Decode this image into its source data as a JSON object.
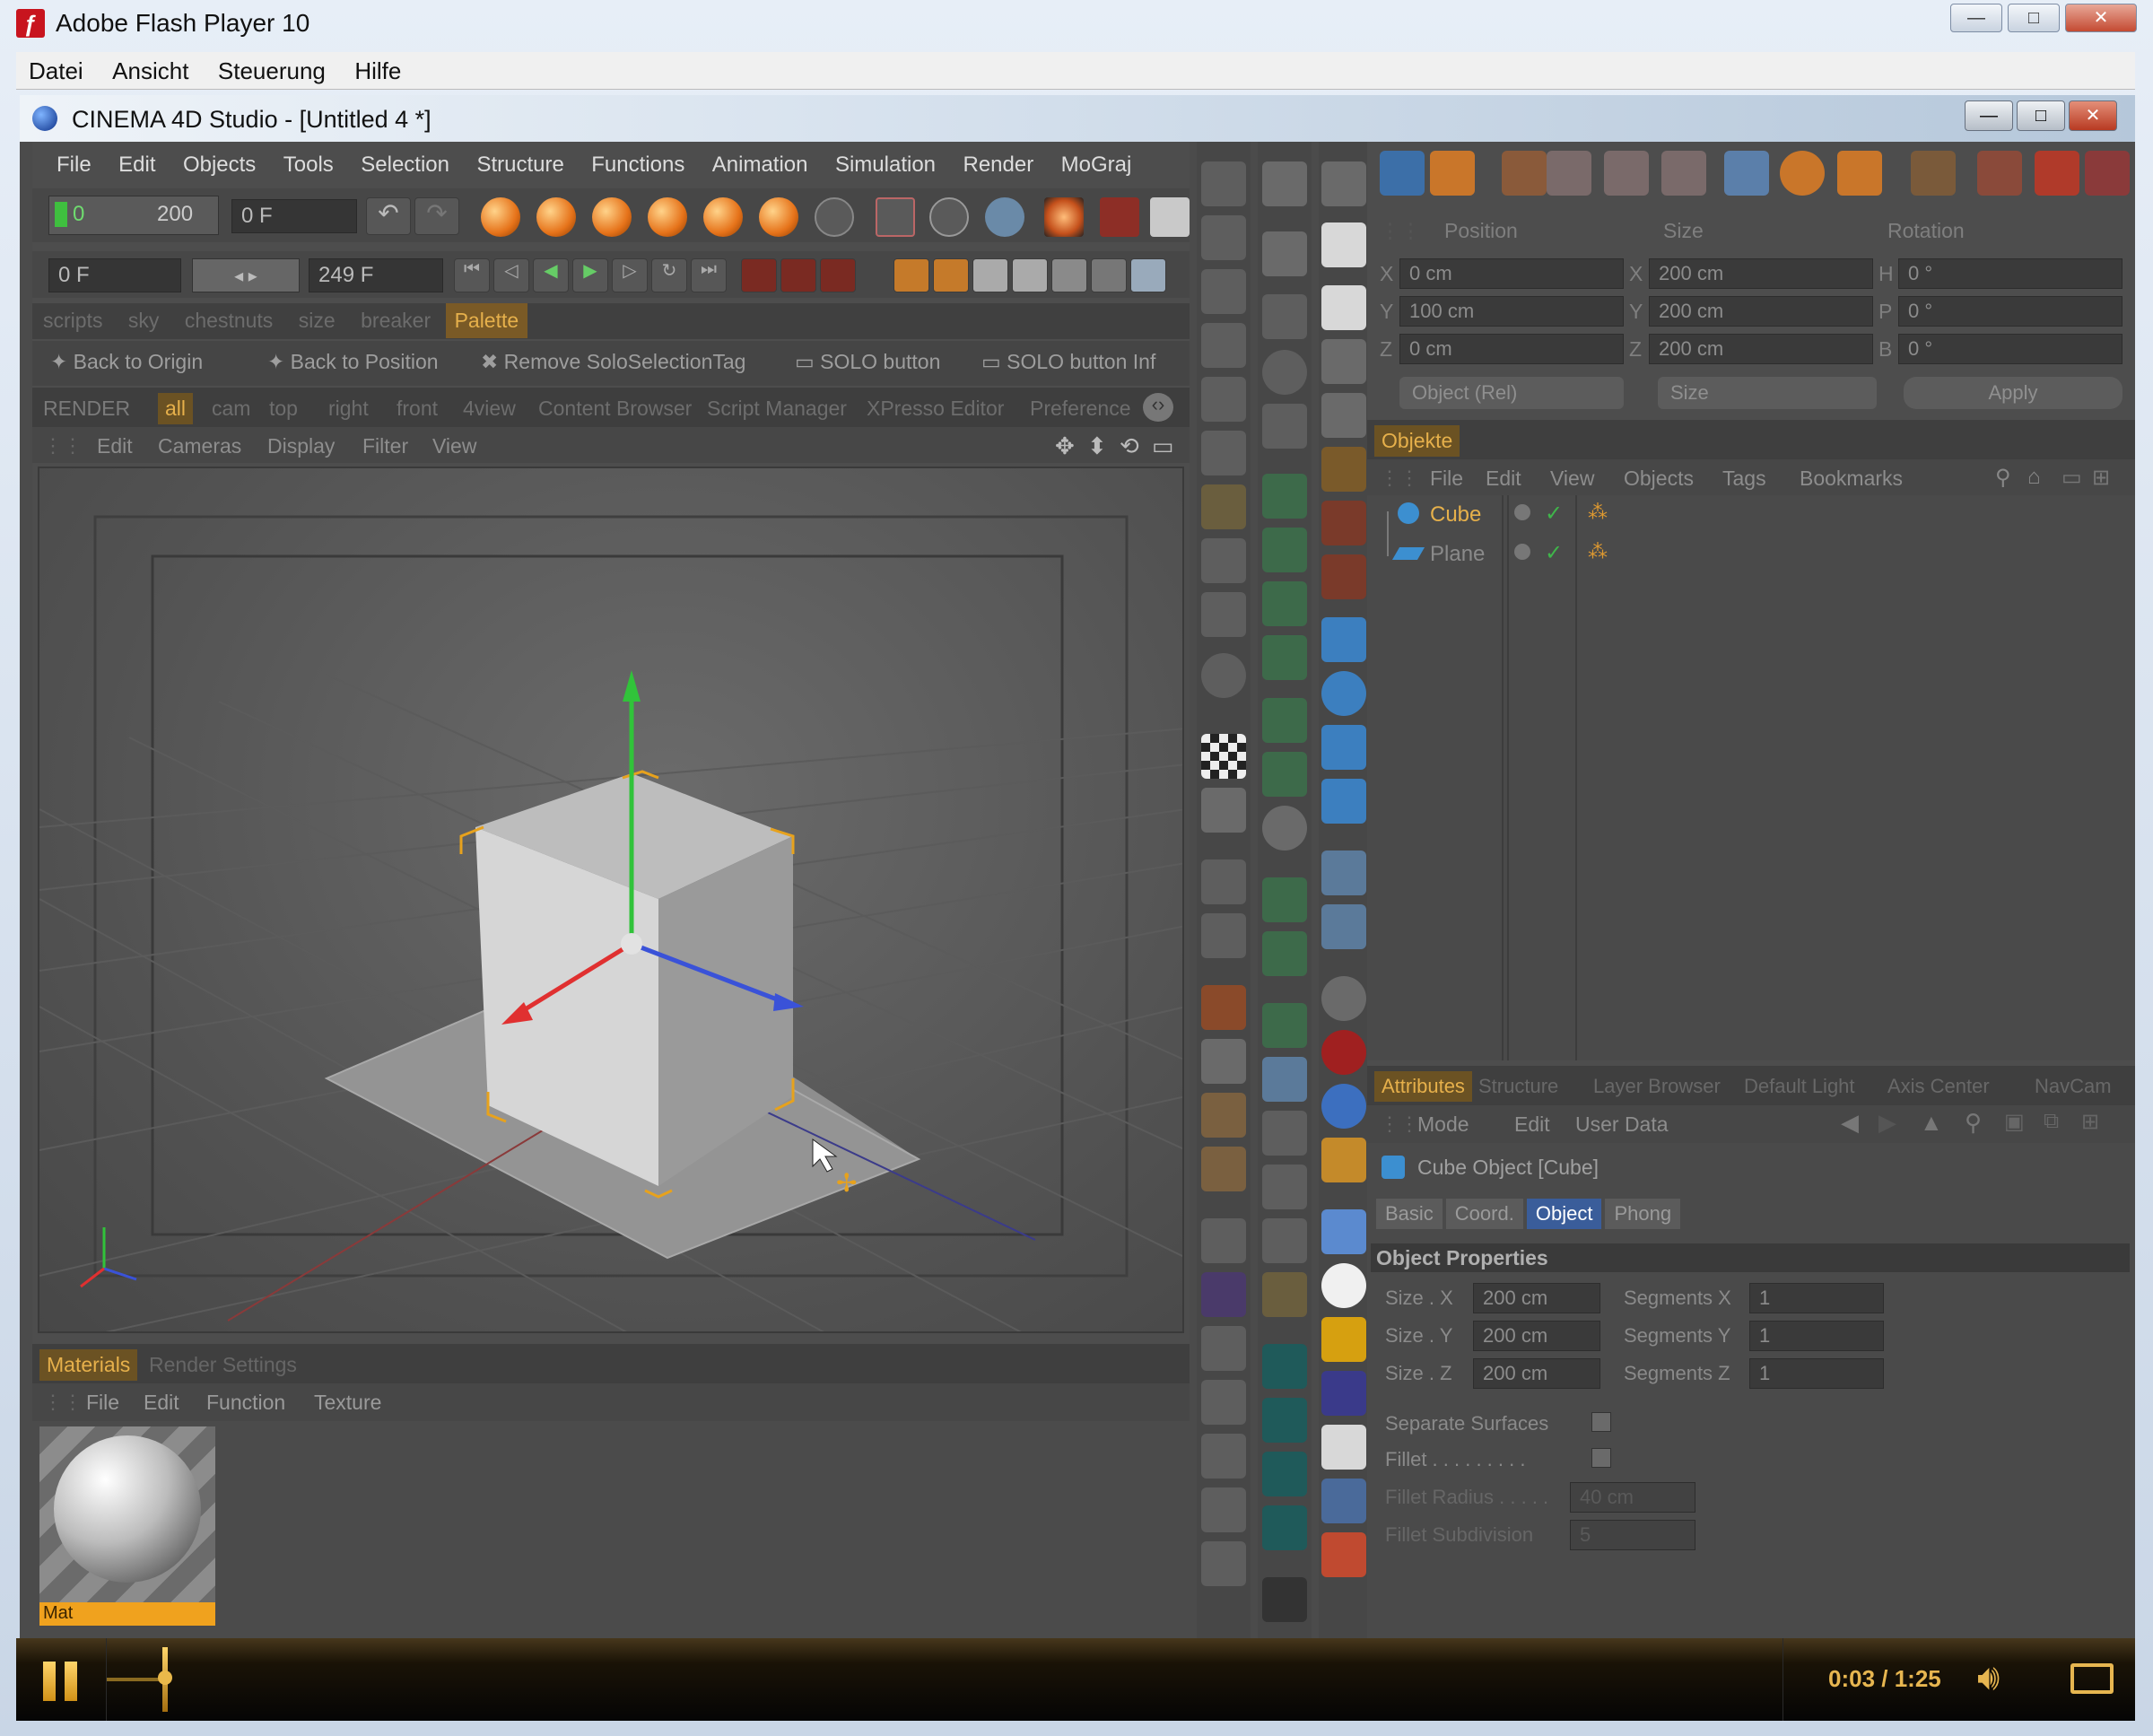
{
  "window": {
    "title": "Adobe Flash Player 10",
    "menu": [
      "Datei",
      "Ansicht",
      "Steuerung",
      "Hilfe"
    ]
  },
  "c4d": {
    "title": "CINEMA 4D Studio - [Untitled 4 *]",
    "menu": [
      "File",
      "Edit",
      "Objects",
      "Tools",
      "Selection",
      "Structure",
      "Functions",
      "Animation",
      "Simulation",
      "Render",
      "MoGraj"
    ],
    "frame_start_value": "0",
    "frame_end_value": "200",
    "current_frame": "0 F",
    "min_frame": "0 F",
    "max_frame": "249 F",
    "palette_tabs": [
      "scripts",
      "sky",
      "chestnuts",
      "size",
      "breaker",
      "Palette"
    ],
    "shortcuts": [
      "Back to Origin",
      "Back to Position",
      "Remove SoloSelectionTag",
      "SOLO button",
      "SOLO button Inf"
    ],
    "view_tabs": [
      "RENDER",
      "all",
      "cam",
      "top",
      "right",
      "front",
      "4view",
      "Content Browser",
      "Script Manager",
      "XPresso Editor",
      "Preference"
    ],
    "viewport_menu": [
      "Edit",
      "Cameras",
      "Display",
      "Filter",
      "View"
    ],
    "material_tabs": [
      "Materials",
      "Render Settings"
    ],
    "material_menu": [
      "File",
      "Edit",
      "Function",
      "Texture"
    ],
    "material_name": "Mat"
  },
  "coords": {
    "headers": [
      "Position",
      "Size",
      "Rotation"
    ],
    "rows": [
      {
        "pl": "X",
        "pv": "0 cm",
        "sl": "X",
        "sv": "200 cm",
        "rl": "H",
        "rv": "0 °"
      },
      {
        "pl": "Y",
        "pv": "100 cm",
        "sl": "Y",
        "sv": "200 cm",
        "rl": "P",
        "rv": "0 °"
      },
      {
        "pl": "Z",
        "pv": "0 cm",
        "sl": "Z",
        "sv": "200 cm",
        "rl": "B",
        "rv": "0 °"
      }
    ],
    "mode_select": "Object (Rel)",
    "size_select": "Size",
    "apply": "Apply"
  },
  "objects": {
    "tab": "Objekte",
    "menu": [
      "File",
      "Edit",
      "View",
      "Objects",
      "Tags",
      "Bookmarks"
    ],
    "items": [
      "Cube",
      "Plane"
    ]
  },
  "attributes": {
    "tabs": [
      "Attributes",
      "Structure",
      "Layer Browser",
      "Default Light",
      "Axis Center",
      "NavCam"
    ],
    "menu": [
      "Mode",
      "Edit",
      "User Data"
    ],
    "object_title": "Cube Object [Cube]",
    "subtabs": [
      "Basic",
      "Coord.",
      "Object",
      "Phong"
    ],
    "section": "Object Properties",
    "size_labels": [
      "Size . X",
      "Size . Y",
      "Size . Z"
    ],
    "size_values": [
      "200 cm",
      "200 cm",
      "200 cm"
    ],
    "seg_labels": [
      "Segments X",
      "Segments Y",
      "Segments Z"
    ],
    "seg_values": [
      "1",
      "1",
      "1"
    ],
    "separate": "Separate Surfaces",
    "fillet": "Fillet . . . . . . . . .",
    "fillet_radius": "Fillet Radius . . . . .",
    "fillet_radius_value": "40 cm",
    "fillet_subdivision": "Fillet Subdivision",
    "fillet_subdivision_value": "5"
  },
  "player": {
    "time": "0:03 / 1:25",
    "progress": 0.035
  },
  "colors": {
    "accent_orange": "#e6b04b",
    "panel_dark": "#4b4b4b"
  }
}
